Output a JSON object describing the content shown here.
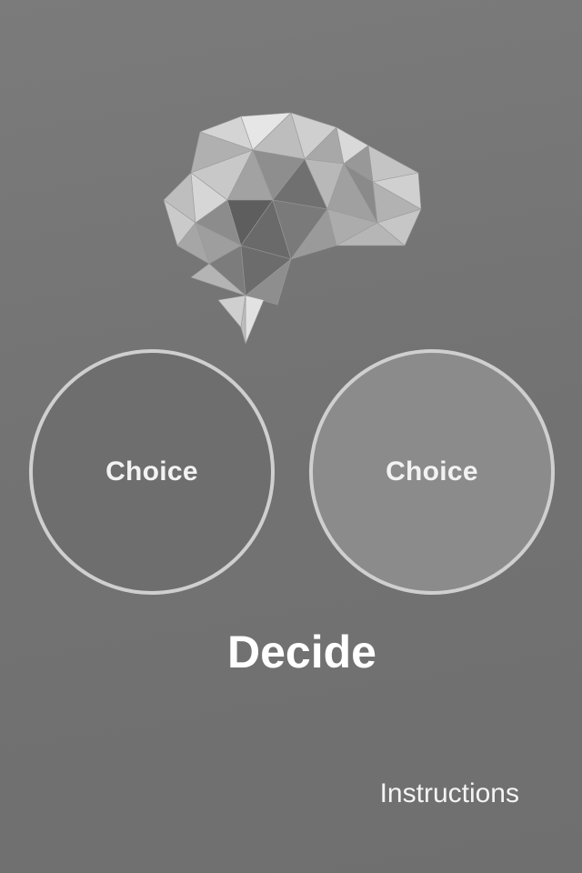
{
  "choices": [
    {
      "label": "Choice"
    },
    {
      "label": "Choice"
    }
  ],
  "decide_label": "Decide",
  "instructions_label": "Instructions",
  "colors": {
    "background": "#757575",
    "circle_left": "#6e6e6e",
    "circle_right": "#8b8b8b",
    "circle_border": "#cfcfcf",
    "text": "#ffffff"
  },
  "icons": {
    "logo": "low-poly-brain-icon"
  }
}
